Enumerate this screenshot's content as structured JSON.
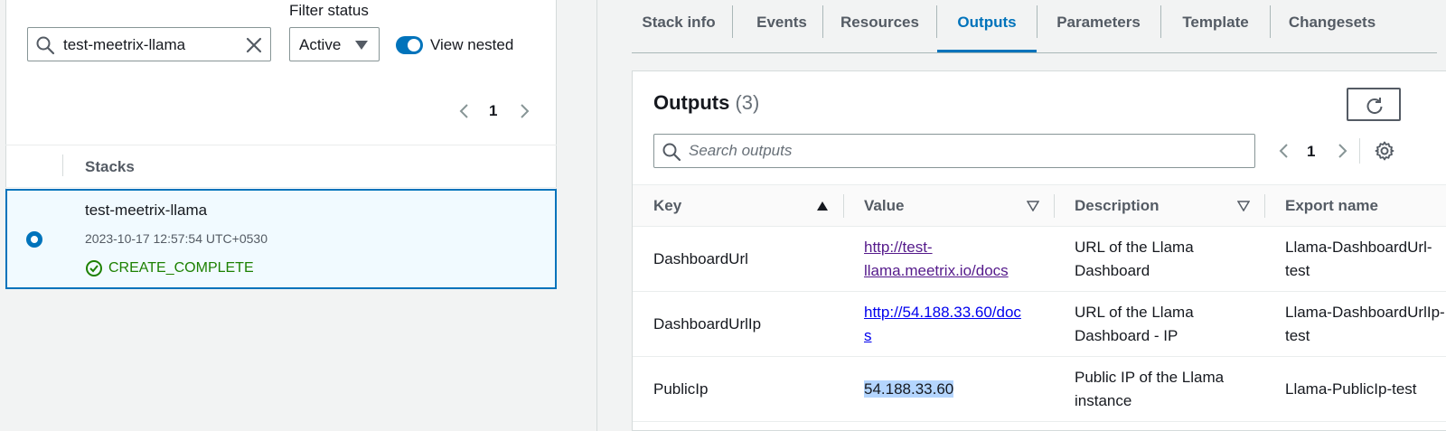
{
  "left": {
    "search": {
      "value": "test-meetrix-llama"
    },
    "filter": {
      "label": "Filter status",
      "value": "Active"
    },
    "toggle": {
      "label": "View nested",
      "on": true
    },
    "pager": {
      "page": "1"
    },
    "stacks_header": "Stacks",
    "stack": {
      "name": "test-meetrix-llama",
      "date": "2023-10-17 12:57:54 UTC+0530",
      "status": "CREATE_COMPLETE",
      "status_color": "#1d8102"
    }
  },
  "tabs": [
    {
      "label": "Stack info",
      "active": false
    },
    {
      "label": "Events",
      "active": false
    },
    {
      "label": "Resources",
      "active": false
    },
    {
      "label": "Outputs",
      "active": true
    },
    {
      "label": "Parameters",
      "active": false
    },
    {
      "label": "Template",
      "active": false
    },
    {
      "label": "Changesets",
      "active": false
    }
  ],
  "outputs": {
    "title": "Outputs",
    "count": "(3)",
    "search_placeholder": "Search outputs",
    "page": "1",
    "columns": [
      "Key",
      "Value",
      "Description",
      "Export name"
    ],
    "rows": [
      {
        "key": "DashboardUrl",
        "value_line1": "http://test-",
        "value_line2": "llama.meetrix.io/docs",
        "description_line1": "URL of the Llama",
        "description_line2": "Dashboard",
        "export_line1": "Llama-DashboardUrl-",
        "export_line2": "test"
      },
      {
        "key": "DashboardUrlIp",
        "value_line1": "http://54.188.33.60/doc",
        "value_line2": "s",
        "description_line1": "URL of the Llama",
        "description_line2": "Dashboard - IP",
        "export_line1": "Llama-DashboardUrlIp-",
        "export_line2": "test"
      },
      {
        "key": "PublicIp",
        "value_line1": "54.188.33.60",
        "description_line1": "Public IP of the Llama",
        "description_line2": "instance",
        "export_line1": "Llama-PublicIp-test"
      }
    ]
  },
  "colors": {
    "accent": "#0073bb",
    "success": "#1d8102"
  }
}
